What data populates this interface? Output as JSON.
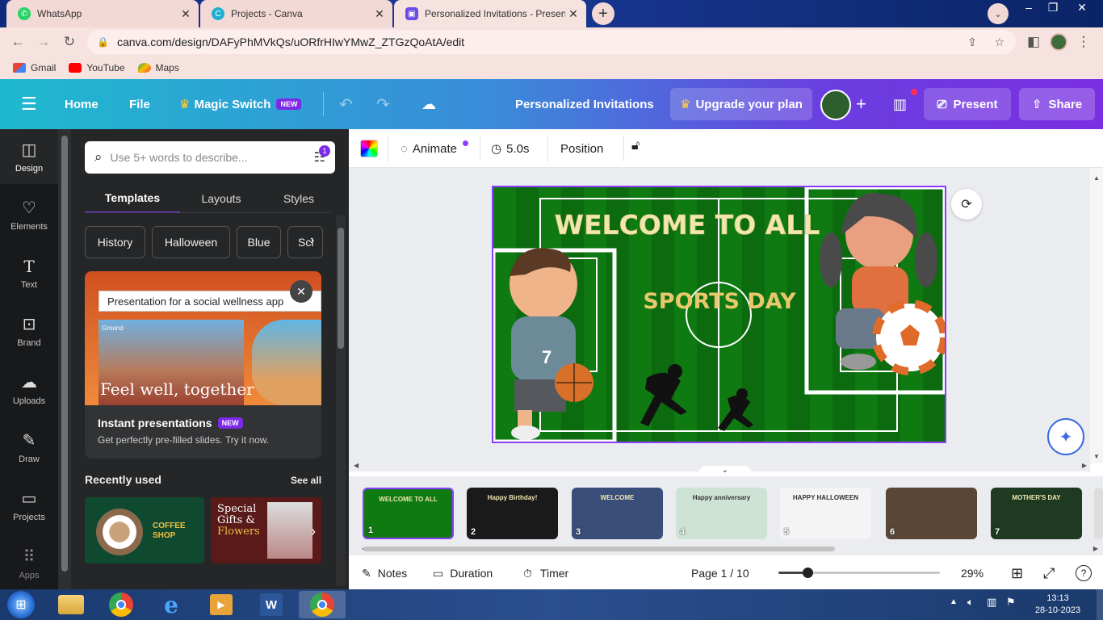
{
  "browser": {
    "tabs": [
      {
        "title": "WhatsApp",
        "icon": "whatsapp-icon"
      },
      {
        "title": "Projects - Canva",
        "icon": "canva-icon"
      },
      {
        "title": "Personalized Invitations - Present",
        "icon": "canva-icon"
      }
    ],
    "url": "canva.com/design/DAFyPhMVkQs/uORfrHIwYMwZ_ZTGzQoAtA/edit",
    "bookmarks": [
      "Gmail",
      "YouTube",
      "Maps"
    ]
  },
  "canva_header": {
    "home": "Home",
    "file": "File",
    "magic_switch": "Magic Switch",
    "new_badge": "NEW",
    "doc_title": "Personalized Invitations",
    "upgrade": "Upgrade your plan",
    "present": "Present",
    "share": "Share"
  },
  "rail": {
    "items": [
      "Design",
      "Elements",
      "Text",
      "Brand",
      "Uploads",
      "Draw",
      "Projects",
      "Apps"
    ]
  },
  "panel": {
    "search_placeholder": "Use 5+ words to describe...",
    "filter_count": "1",
    "tabs": [
      "Templates",
      "Layouts",
      "Styles"
    ],
    "chips": [
      "History",
      "Halloween",
      "Blue",
      "Sci"
    ],
    "promo_input": "Presentation for a social wellness app",
    "promo_image_text": "Feel well, together",
    "promo_brand": "Ground",
    "promo_title": "Instant presentations",
    "promo_badge": "NEW",
    "promo_sub": "Get perfectly pre-filled slides. Try it now.",
    "recent_label": "Recently used",
    "see_all": "See all",
    "recent1_title": "COFFEE SHOP",
    "recent2_title_1": "Special",
    "recent2_title_2": "Gifts &",
    "recent2_title_3": "Flowers"
  },
  "context_bar": {
    "animate": "Animate",
    "duration": "5.0s",
    "position": "Position"
  },
  "slide": {
    "title": "WELCOME TO ALL",
    "subtitle": "SPORTS DAY",
    "colors": {
      "field": "#0f7a12",
      "title": "#f0e6b0",
      "subtitle": "#e8c86a"
    }
  },
  "thumbnails": [
    {
      "num": "1",
      "label": "WELCOME TO ALL",
      "bg": "#0f7a12"
    },
    {
      "num": "2",
      "label": "Happy Birthday!",
      "bg": "#1a1a1a"
    },
    {
      "num": "3",
      "label": "WELCOME",
      "bg": "#3a4e7a"
    },
    {
      "num": "4",
      "label": "Happy anniversary",
      "bg": "#cde3d6"
    },
    {
      "num": "5",
      "label": "HAPPY HALLOWEEN",
      "bg": "#f4f4f4"
    },
    {
      "num": "6",
      "label": "",
      "bg": "#5a4636"
    },
    {
      "num": "7",
      "label": "MOTHER'S DAY",
      "bg": "#1e3b22"
    }
  ],
  "footer": {
    "notes": "Notes",
    "duration": "Duration",
    "timer": "Timer",
    "page": "Page 1 / 10",
    "zoom": "29%",
    "zoom_level": 0.29
  },
  "taskbar": {
    "time": "13:13",
    "date": "28-10-2023"
  }
}
